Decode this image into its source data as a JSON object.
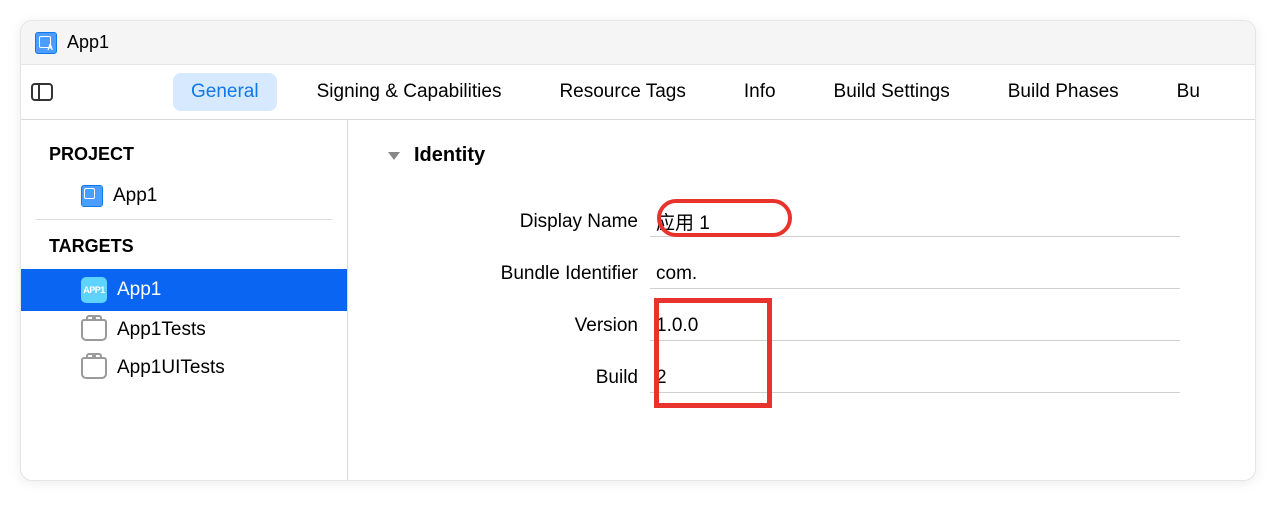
{
  "titlebar": {
    "app_name": "App1"
  },
  "tabs": {
    "general": "General",
    "signing": "Signing & Capabilities",
    "resource": "Resource Tags",
    "info": "Info",
    "build_settings": "Build Settings",
    "build_phases": "Build Phases",
    "build_rules": "Bu"
  },
  "sidebar": {
    "project_heading": "PROJECT",
    "project_item": "App1",
    "targets_heading": "TARGETS",
    "targets": [
      {
        "label": "App1",
        "icon_text": "APP1"
      },
      {
        "label": "App1Tests"
      },
      {
        "label": "App1UITests"
      }
    ]
  },
  "section": {
    "title": "Identity",
    "display_name": {
      "label": "Display Name",
      "value": "应用 1"
    },
    "bundle_id": {
      "label": "Bundle Identifier",
      "value": "com."
    },
    "version": {
      "label": "Version",
      "value": "1.0.0"
    },
    "build": {
      "label": "Build",
      "value": "2"
    }
  }
}
